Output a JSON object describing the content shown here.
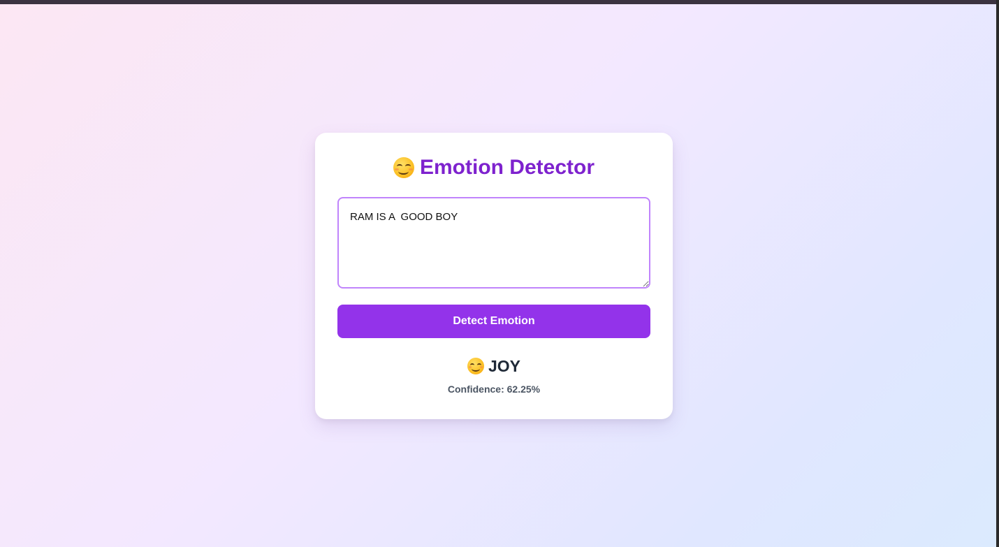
{
  "header": {
    "title": "Emotion Detector",
    "title_icon": "smiling-face-icon",
    "title_color": "#7e22ce"
  },
  "input": {
    "value": "RAM IS A  GOOD BOY",
    "border_color": "#c084fc"
  },
  "button": {
    "label": "Detect Emotion",
    "color": "#9333ea"
  },
  "result": {
    "emotion": "JOY",
    "emotion_icon": "smiling-face-icon",
    "confidence_text": "Confidence: 62.25%",
    "confidence_value": 62.25
  }
}
